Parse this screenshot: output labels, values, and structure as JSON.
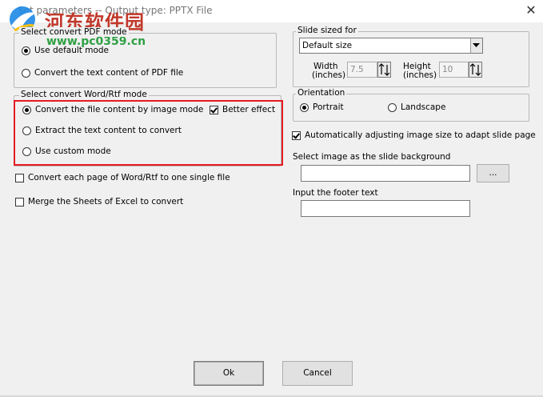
{
  "window": {
    "title": "Set parameters -- Output type: PPTX File",
    "close_glyph": "✕"
  },
  "watermark": {
    "site_name": "河东软件园",
    "url": "www.pc0359.cn"
  },
  "pdf_mode": {
    "legend": "Select convert PDF mode",
    "options": [
      {
        "label": "Use default mode",
        "selected": true
      },
      {
        "label": "Convert the text content of PDF file",
        "selected": false
      }
    ]
  },
  "word_mode": {
    "legend": "Select convert Word/Rtf mode",
    "options": [
      {
        "label": "Convert the file content by image mode",
        "selected": true
      },
      {
        "label": "Extract the text content to convert",
        "selected": false
      },
      {
        "label": "Use custom mode",
        "selected": false
      }
    ],
    "better_effect": {
      "label": "Better effect",
      "checked": true
    }
  },
  "single_file": {
    "label": "Convert each page of Word/Rtf to one single file",
    "checked": false
  },
  "merge_sheets": {
    "label": "Merge the Sheets of Excel to convert",
    "checked": false
  },
  "slide_size": {
    "legend": "Slide sized for",
    "selected": "Default size",
    "width_label": "Width",
    "width_unit": "(inches)",
    "width_value": "7.5",
    "height_label": "Height",
    "height_unit": "(inches)",
    "height_value": "10"
  },
  "orientation": {
    "legend": "Orientation",
    "options": [
      {
        "label": "Portrait",
        "selected": true
      },
      {
        "label": "Landscape",
        "selected": false
      }
    ]
  },
  "auto_adjust": {
    "label": "Automatically adjusting image size to adapt slide page",
    "checked": true
  },
  "background": {
    "label": "Select image as the slide background",
    "value": "",
    "browse_label": "..."
  },
  "footer": {
    "label": "Input the footer text",
    "value": ""
  },
  "buttons": {
    "ok": "Ok",
    "cancel": "Cancel"
  },
  "colors": {
    "highlight": "#e51c23",
    "watermark_red": "#c0392b",
    "watermark_green": "#2ea043"
  }
}
